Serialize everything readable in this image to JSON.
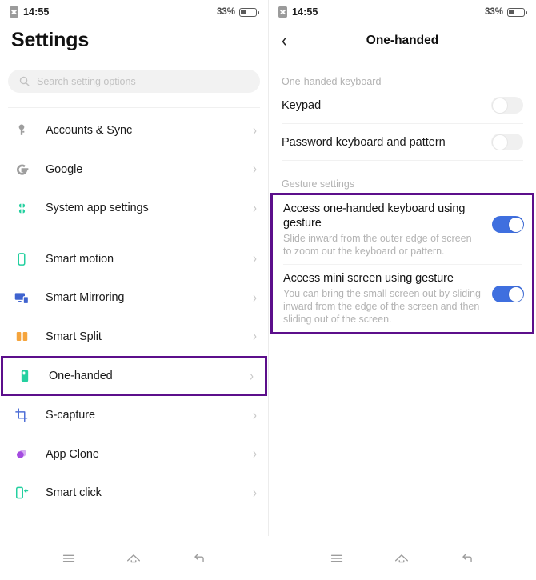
{
  "status_bar": {
    "time": "14:55",
    "battery_pct": "33%",
    "battery_level": 33,
    "sim_icon": "sim-card-off-icon"
  },
  "left_panel": {
    "title": "Settings",
    "search": {
      "placeholder": "Search setting options",
      "icon": "search-icon"
    },
    "items": [
      {
        "label": "Accounts & Sync",
        "icon": "key-icon",
        "color": "#9e9e9e",
        "highlighted": false
      },
      {
        "label": "Google",
        "icon": "google-g-icon",
        "color": "#9e9e9e",
        "highlighted": false
      },
      {
        "label": "System app settings",
        "icon": "four-petals-icon",
        "color": "#25d0a0",
        "highlighted": false
      },
      {
        "label": "Smart motion",
        "icon": "phone-outline-icon",
        "color": "#25d0a0",
        "highlighted": false
      },
      {
        "label": "Smart Mirroring",
        "icon": "monitor-phone-icon",
        "color": "#3f63cf",
        "highlighted": false
      },
      {
        "label": "Smart Split",
        "icon": "split-panels-icon",
        "color": "#f5a43c",
        "highlighted": false
      },
      {
        "label": "One-handed",
        "icon": "one-handed-icon",
        "color": "#25d0a0",
        "highlighted": true
      },
      {
        "label": "S-capture",
        "icon": "crop-icon",
        "color": "#4f6fd6",
        "highlighted": false
      },
      {
        "label": "App Clone",
        "icon": "app-clone-icon",
        "color": "#a44be0",
        "highlighted": false
      },
      {
        "label": "Smart click",
        "icon": "smart-click-icon",
        "color": "#25d0a0",
        "highlighted": false
      }
    ],
    "divider_after_index": 2,
    "chevron": "›"
  },
  "right_panel": {
    "back_icon": "chevron-left-icon",
    "back_glyph": "‹",
    "title": "One-handed",
    "sections": [
      {
        "header": "One-handed keyboard",
        "rows": [
          {
            "label": "Keypad",
            "toggle": "off"
          },
          {
            "label": "Password keyboard and pattern",
            "toggle": "off"
          }
        ]
      },
      {
        "header": "Gesture settings",
        "highlighted": true,
        "rows": [
          {
            "label": "Access one-handed keyboard using gesture",
            "description": "Slide inward from the outer edge of screen to zoom out the keyboard or pattern.",
            "toggle": "on"
          },
          {
            "label": "Access mini screen using gesture",
            "description": "You can bring the small screen out by sliding inward from the edge of the screen and then sliding out of the screen.",
            "toggle": "on"
          }
        ]
      }
    ]
  },
  "bottom_nav": {
    "buttons": [
      {
        "icon": "recents-menu-icon"
      },
      {
        "icon": "home-icon"
      },
      {
        "icon": "back-icon"
      }
    ]
  },
  "colors": {
    "highlight_box": "#5c0f8b",
    "toggle_on": "#3f6fdf",
    "toggle_off": "#f0f0f0",
    "accent_teal": "#25d0a0"
  }
}
